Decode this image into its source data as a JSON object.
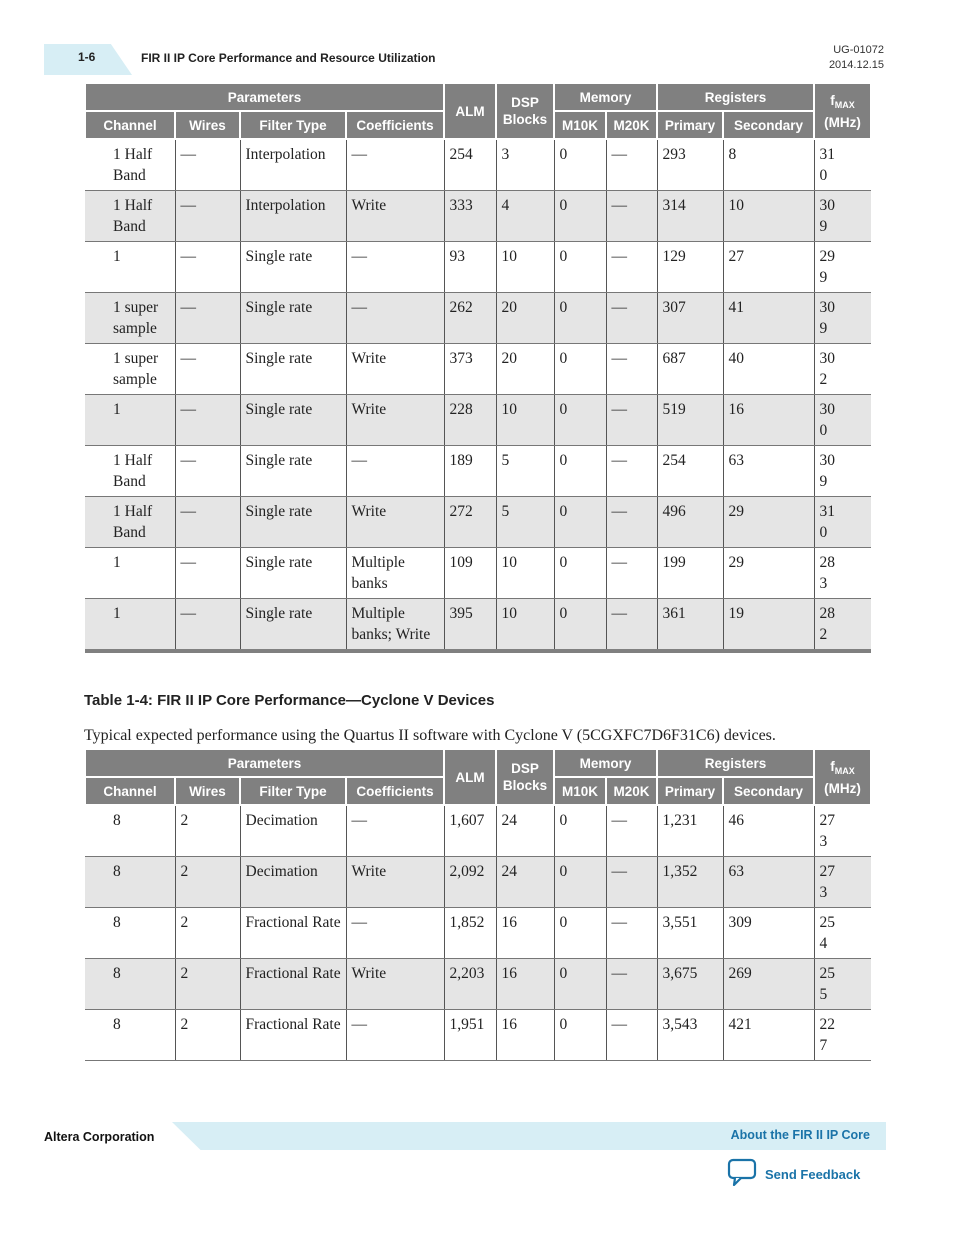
{
  "header": {
    "page_number": "1-6",
    "section_title": "FIR II IP Core Performance and Resource Utilization",
    "doc_id": "UG-01072",
    "doc_date": "2014.12.15"
  },
  "columns": {
    "parameters": "Parameters",
    "alm": "ALM",
    "dsp_line1": "DSP",
    "dsp_line2": "Blocks",
    "memory": "Memory",
    "registers": "Registers",
    "fmax_f": "f",
    "fmax_sub": "MAX",
    "fmax_unit": "(MHz)",
    "channel": "Channel",
    "wires": "Wires",
    "filter_type": "Filter Type",
    "coefficients": "Coefficients",
    "m10k": "M10K",
    "m20k": "M20K",
    "primary": "Primary",
    "secondary": "Secondary"
  },
  "table1": {
    "rows": [
      {
        "channel": "1 Half Band",
        "wires": "—",
        "filter_type": "Interpolation",
        "coefficients": "—",
        "alm": "254",
        "dsp": "3",
        "m10k": "0",
        "m20k": "—",
        "primary": "293",
        "secondary": "8",
        "fmax": "310"
      },
      {
        "channel": "1 Half Band",
        "wires": "—",
        "filter_type": "Interpolation",
        "coefficients": "Write",
        "alm": "333",
        "dsp": "4",
        "m10k": "0",
        "m20k": "—",
        "primary": "314",
        "secondary": "10",
        "fmax": "309"
      },
      {
        "channel": "1",
        "wires": "—",
        "filter_type": "Single rate",
        "coefficients": "—",
        "alm": "93",
        "dsp": "10",
        "m10k": "0",
        "m20k": "—",
        "primary": "129",
        "secondary": "27",
        "fmax": "299"
      },
      {
        "channel": "1 super sample",
        "wires": "—",
        "filter_type": "Single rate",
        "coefficients": "—",
        "alm": "262",
        "dsp": "20",
        "m10k": "0",
        "m20k": "—",
        "primary": "307",
        "secondary": "41",
        "fmax": "309"
      },
      {
        "channel": "1 super sample",
        "wires": "—",
        "filter_type": "Single rate",
        "coefficients": "Write",
        "alm": "373",
        "dsp": "20",
        "m10k": "0",
        "m20k": "—",
        "primary": "687",
        "secondary": "40",
        "fmax": "302"
      },
      {
        "channel": "1",
        "wires": "—",
        "filter_type": "Single rate",
        "coefficients": "Write",
        "alm": "228",
        "dsp": "10",
        "m10k": "0",
        "m20k": "—",
        "primary": "519",
        "secondary": "16",
        "fmax": "300"
      },
      {
        "channel": "1 Half Band",
        "wires": "—",
        "filter_type": "Single rate",
        "coefficients": "—",
        "alm": "189",
        "dsp": "5",
        "m10k": "0",
        "m20k": "—",
        "primary": "254",
        "secondary": "63",
        "fmax": "309"
      },
      {
        "channel": "1 Half Band",
        "wires": "—",
        "filter_type": "Single rate",
        "coefficients": "Write",
        "alm": "272",
        "dsp": "5",
        "m10k": "0",
        "m20k": "—",
        "primary": "496",
        "secondary": "29",
        "fmax": "310"
      },
      {
        "channel": "1",
        "wires": "—",
        "filter_type": "Single rate",
        "coefficients": "Multiple banks",
        "alm": "109",
        "dsp": "10",
        "m10k": "0",
        "m20k": "—",
        "primary": "199",
        "secondary": "29",
        "fmax": "283"
      },
      {
        "channel": "1",
        "wires": "—",
        "filter_type": "Single rate",
        "coefficients": "Multiple banks; Write",
        "alm": "395",
        "dsp": "10",
        "m10k": "0",
        "m20k": "—",
        "primary": "361",
        "secondary": "19",
        "fmax": "282"
      }
    ]
  },
  "table2": {
    "caption": "Table 1-4: FIR II IP Core Performance—Cyclone V Devices",
    "description": "Typical expected performance using the Quartus II software with Cyclone V (5CGXFC7D6F31C6) devices.",
    "rows": [
      {
        "channel": "8",
        "wires": "2",
        "filter_type": "Decimation",
        "coefficients": "—",
        "alm": "1,607",
        "dsp": "24",
        "m10k": "0",
        "m20k": "—",
        "primary": "1,231",
        "secondary": "46",
        "fmax": "273"
      },
      {
        "channel": "8",
        "wires": "2",
        "filter_type": "Decimation",
        "coefficients": "Write",
        "alm": "2,092",
        "dsp": "24",
        "m10k": "0",
        "m20k": "—",
        "primary": "1,352",
        "secondary": "63",
        "fmax": "273"
      },
      {
        "channel": "8",
        "wires": "2",
        "filter_type": "Fractional Rate",
        "coefficients": "—",
        "alm": "1,852",
        "dsp": "16",
        "m10k": "0",
        "m20k": "—",
        "primary": "3,551",
        "secondary": "309",
        "fmax": "254"
      },
      {
        "channel": "8",
        "wires": "2",
        "filter_type": "Fractional Rate",
        "coefficients": "Write",
        "alm": "2,203",
        "dsp": "16",
        "m10k": "0",
        "m20k": "—",
        "primary": "3,675",
        "secondary": "269",
        "fmax": "255"
      },
      {
        "channel": "8",
        "wires": "2",
        "filter_type": "Fractional Rate",
        "coefficients": "—",
        "alm": "1,951",
        "dsp": "16",
        "m10k": "0",
        "m20k": "—",
        "primary": "3,543",
        "secondary": "421",
        "fmax": "227"
      }
    ]
  },
  "footer": {
    "company": "Altera Corporation",
    "chapter_link": "About the FIR II IP Core",
    "feedback_label": "Send Feedback",
    "feedback_icon": "speech-bubble-icon",
    "accent_color": "#1a73a8"
  }
}
